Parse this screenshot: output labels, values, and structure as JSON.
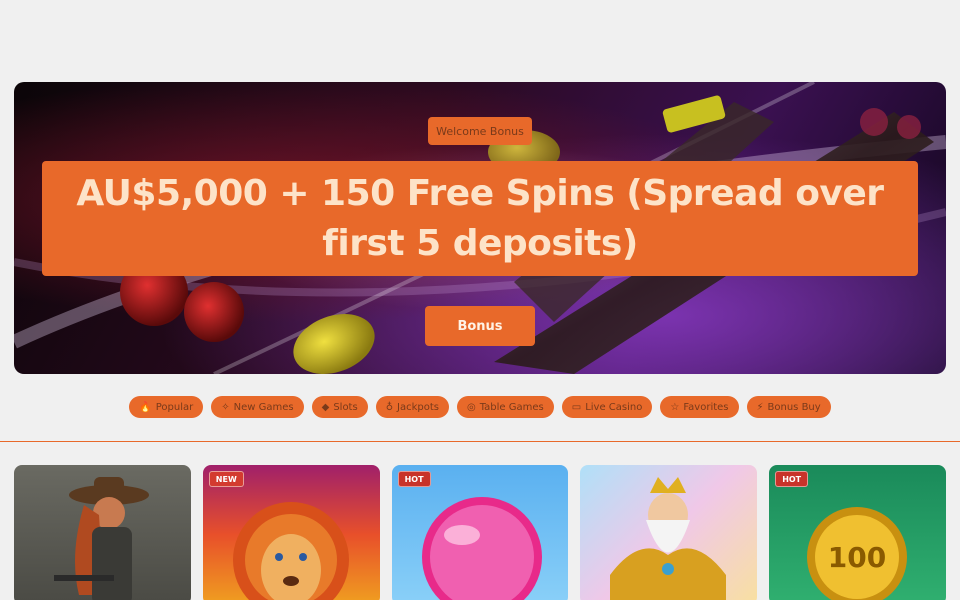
{
  "hero": {
    "welcome_label": "Welcome Bonus",
    "title": "AU$5,000 + 150 Free Spins (Spread over first 5 deposits)",
    "button_label": "Bonus"
  },
  "categories": [
    {
      "icon": "fire-icon",
      "glyph": "🔥",
      "label": "Popular"
    },
    {
      "icon": "sparkle-icon",
      "glyph": "✧",
      "label": "New Games"
    },
    {
      "icon": "diamond-icon",
      "glyph": "◆",
      "label": "Slots"
    },
    {
      "icon": "trophy-icon",
      "glyph": "♁",
      "label": "Jackpots"
    },
    {
      "icon": "chip-icon",
      "glyph": "◎",
      "label": "Table Games"
    },
    {
      "icon": "video-icon",
      "glyph": "▭",
      "label": "Live Casino"
    },
    {
      "icon": "star-icon",
      "glyph": "☆",
      "label": "Favorites"
    },
    {
      "icon": "bolt-icon",
      "glyph": "⚡",
      "label": "Bonus Buy"
    }
  ],
  "games": [
    {
      "name": "cowgirl",
      "badge": ""
    },
    {
      "name": "lion",
      "badge": "NEW"
    },
    {
      "name": "candy",
      "badge": "HOT"
    },
    {
      "name": "zeus",
      "badge": ""
    },
    {
      "name": "coin",
      "badge": "HOT"
    }
  ],
  "colors": {
    "accent": "#e8692a",
    "background": "#f0f0f0",
    "badge_red": "#d33b2f"
  }
}
